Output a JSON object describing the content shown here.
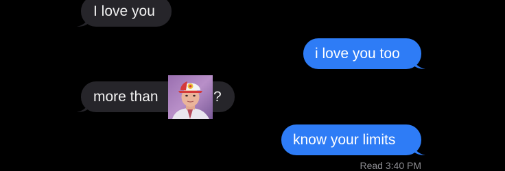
{
  "conversation": {
    "messages": [
      {
        "sender": "them",
        "text": "I love you"
      },
      {
        "sender": "me",
        "text": "i love you too"
      },
      {
        "sender": "them",
        "text_before_image": "more than",
        "text_after_image": "?"
      },
      {
        "sender": "me",
        "text": "know your limits"
      }
    ],
    "read_receipt": "Read 3:40 PM"
  },
  "colors": {
    "background": "#000000",
    "incoming_bubble": "#26252a",
    "outgoing_bubble": "#2e7cf6",
    "text_light": "#ffffff",
    "receipt_text": "#8e8e93"
  }
}
